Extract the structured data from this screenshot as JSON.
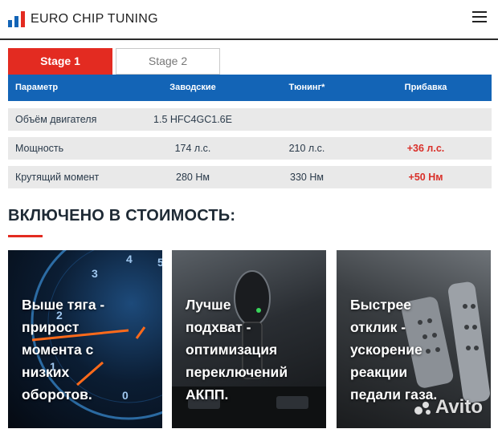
{
  "header": {
    "logo_text": "EURO CHIP TUNING",
    "logo_icon": "bar-chart-logo-icon",
    "menu_icon": "hamburger-menu-icon"
  },
  "tabs": [
    {
      "label": "Stage 1",
      "active": true
    },
    {
      "label": "Stage 2",
      "active": false
    }
  ],
  "table": {
    "headers": [
      "Параметр",
      "Заводские",
      "Тюнинг*",
      "Прибавка"
    ],
    "rows": [
      {
        "param": "Объём двигателя",
        "factory": "1.5 HFC4GC1.6E",
        "tuned": "",
        "gain": ""
      },
      {
        "param": "Мощность",
        "factory": "174 л.с.",
        "tuned": "210 л.с.",
        "gain": "+36 л.с."
      },
      {
        "param": "Крутящий момент",
        "factory": "280 Нм",
        "tuned": "330 Нм",
        "gain": "+50 Нм"
      }
    ]
  },
  "included": {
    "title": "ВКЛЮЧЕНО В СТОИМОСТЬ:",
    "cards": [
      {
        "lines": [
          "Выше тяга -",
          "прирост",
          "момента с",
          "низких",
          "оборотов."
        ],
        "image": "tachometer"
      },
      {
        "lines": [
          "Лучше",
          "подхват -",
          "оптимизация",
          "переключений",
          "АКПП."
        ],
        "image": "gear-shifter"
      },
      {
        "lines": [
          "Быстрее",
          "отклик -",
          "ускорение",
          "реакции",
          "педали газа."
        ],
        "image": "pedals"
      }
    ]
  },
  "watermark": "Avito",
  "colors": {
    "accent_red": "#e32b21",
    "table_header_blue": "#1364b6",
    "row_gray": "#e9e9e9",
    "gain_red": "#d9302a"
  }
}
